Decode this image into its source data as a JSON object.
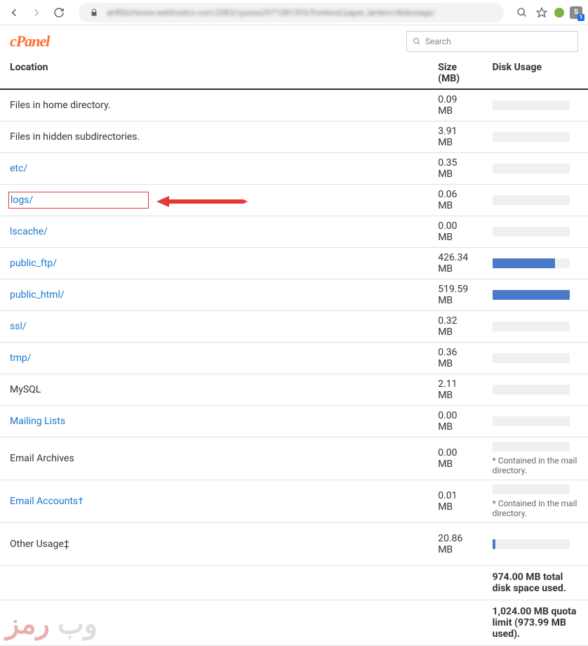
{
  "browser": {
    "url_blur": "aHR0cHwww.webhostco.com:2083/cpsess2971081393/frontend/paper_lantern/diskusage/",
    "ext_letter": "S"
  },
  "header": {
    "logo": "cPanel",
    "search_placeholder": "Search"
  },
  "table": {
    "headers": {
      "location": "Location",
      "size": "Size (MB)",
      "usage": "Disk Usage"
    },
    "rows": [
      {
        "label": "Files in home directory.",
        "link": false,
        "size": "0.09 MB",
        "bar": 0,
        "highlight": false,
        "note": ""
      },
      {
        "label": "Files in hidden subdirectories.",
        "link": false,
        "size": "3.91 MB",
        "bar": 0,
        "highlight": false,
        "note": ""
      },
      {
        "label": "etc/",
        "link": true,
        "size": "0.35 MB",
        "bar": 0,
        "highlight": false,
        "note": ""
      },
      {
        "label": "logs/",
        "link": true,
        "size": "0.06 MB",
        "bar": 0,
        "highlight": true,
        "note": ""
      },
      {
        "label": "lscache/",
        "link": true,
        "size": "0.00 MB",
        "bar": 0,
        "highlight": false,
        "note": ""
      },
      {
        "label": "public_ftp/",
        "link": true,
        "size": "426.34 MB",
        "bar": 81,
        "highlight": false,
        "note": ""
      },
      {
        "label": "public_html/",
        "link": true,
        "size": "519.59 MB",
        "bar": 100,
        "highlight": false,
        "note": ""
      },
      {
        "label": "ssl/",
        "link": true,
        "size": "0.32 MB",
        "bar": 0,
        "highlight": false,
        "note": ""
      },
      {
        "label": "tmp/",
        "link": true,
        "size": "0.36 MB",
        "bar": 0,
        "highlight": false,
        "note": ""
      },
      {
        "label": "MySQL",
        "link": false,
        "size": "2.11 MB",
        "bar": 0,
        "highlight": false,
        "note": ""
      },
      {
        "label": "Mailing Lists",
        "link": true,
        "size": "0.00 MB",
        "bar": 0,
        "highlight": false,
        "note": ""
      },
      {
        "label": "Email Archives",
        "link": false,
        "size": "0.00 MB",
        "bar": 0,
        "highlight": false,
        "note": "* Contained in the mail directory.",
        "pad": true
      },
      {
        "label": "Email Accounts†",
        "link": true,
        "size": "0.01 MB",
        "bar": 0,
        "highlight": false,
        "note": "* Contained in the mail directory.",
        "pad": true
      },
      {
        "label": "Other Usage‡",
        "link": false,
        "size": "20.86 MB",
        "bar": 4,
        "highlight": false,
        "note": "",
        "pad": true
      }
    ],
    "totals": [
      "974.00 MB total disk space used.",
      "1,024.00 MB quota limit (973.99 MB used)."
    ]
  },
  "watermark": {
    "t1": "وب",
    "t2": "رمز"
  }
}
